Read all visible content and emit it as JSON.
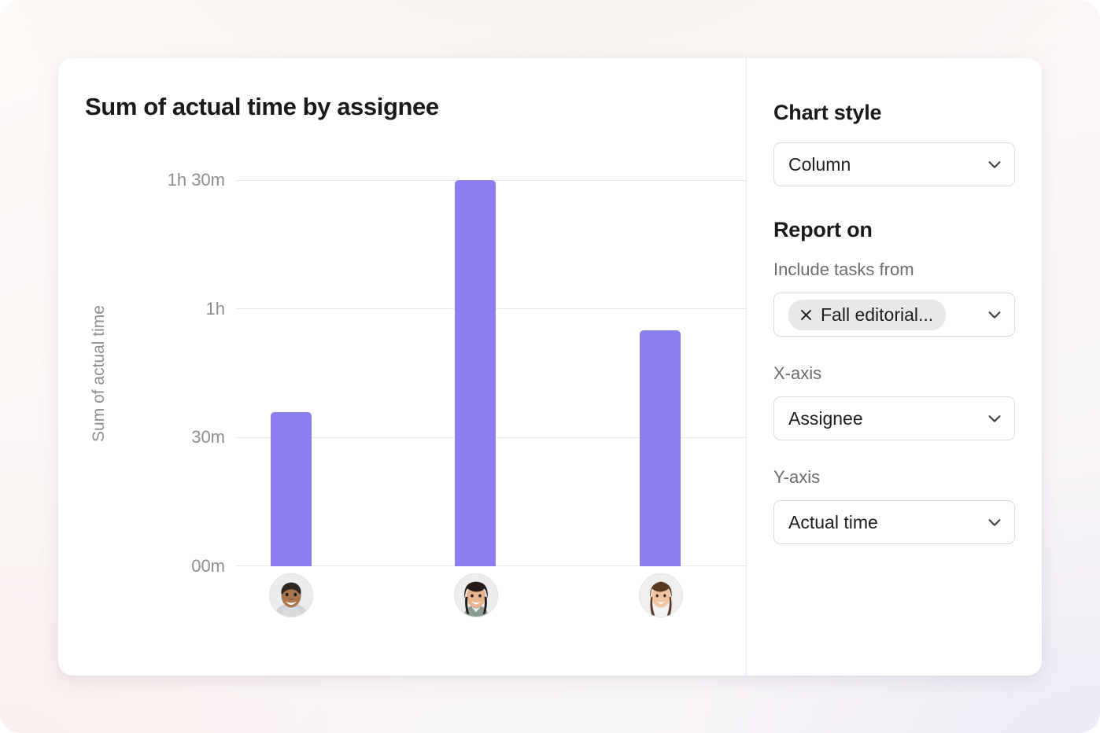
{
  "chart": {
    "title": "Sum of actual time by assignee"
  },
  "settings": {
    "chart_style": {
      "heading": "Chart style",
      "value": "Column",
      "chevron": "chevron-down-icon"
    },
    "report_on": {
      "heading": "Report on",
      "include_tasks_from": {
        "label": "Include tasks from",
        "chip_text": "Fall editorial...",
        "chip_remove_icon": "close-icon",
        "chevron": "chevron-down-icon"
      },
      "x_axis": {
        "label": "X-axis",
        "value": "Assignee",
        "chevron": "chevron-down-icon"
      },
      "y_axis": {
        "label": "Y-axis",
        "value": "Actual time",
        "chevron": "chevron-down-icon"
      }
    }
  },
  "colors": {
    "bar": "#8b7ef0",
    "gridline": "#e9e9ec",
    "axis_text": "#8e8e93",
    "card": "#ffffff"
  },
  "chart_data": {
    "type": "bar",
    "title": "Sum of actual time by assignee",
    "xlabel": "",
    "ylabel": "Sum of actual time",
    "categories": [
      "assignee-1",
      "assignee-2",
      "assignee-3"
    ],
    "category_icons": [
      "avatar-man",
      "avatar-woman-dark-hair",
      "avatar-woman-brown-hair"
    ],
    "values": [
      36,
      90,
      55
    ],
    "value_labels": [
      "36m",
      "1h 30m",
      "55m"
    ],
    "unit": "minutes",
    "ylim": [
      0,
      90
    ],
    "ytick_values": [
      90,
      60,
      30,
      0
    ],
    "ytick_labels": [
      "1h 30m",
      "1h",
      "30m",
      "00m"
    ],
    "grid": true,
    "legend": false,
    "series": [
      {
        "name": "Sum of actual time",
        "values": [
          36,
          90,
          55
        ],
        "color": "#8b7ef0"
      }
    ]
  }
}
